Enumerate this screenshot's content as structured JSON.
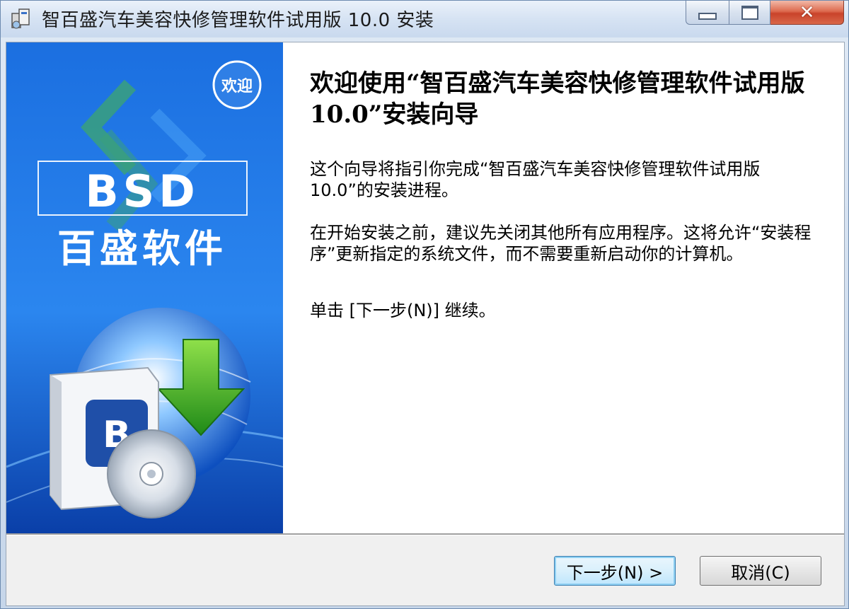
{
  "window": {
    "title": "智百盛汽车美容快修管理软件试用版 10.0 安装"
  },
  "banner": {
    "badge": "欢迎",
    "logo_text": "BSD",
    "brand_text": "百盛软件",
    "box_letter": "B"
  },
  "content": {
    "heading": "欢迎使用“智百盛汽车美容快修管理软件试用版 10.0”安装向导",
    "paragraphs": [
      "这个向导将指引你完成“智百盛汽车美容快修管理软件试用版 10.0”的安装进程。",
      "在开始安装之前，建议先关闭其他所有应用程序。这将允许“安装程序”更新指定的系统文件，而不需要重新启动你的计算机。",
      "单击 [下一步(N)] 继续。"
    ]
  },
  "buttons": {
    "next": "下一步(N) >",
    "cancel": "取消(C)"
  },
  "colors": {
    "banner_top": "#1b6fe0",
    "banner_bottom": "#0a3fa8",
    "title_bar": "#d6e3f3",
    "close_button": "#d04a2e"
  }
}
